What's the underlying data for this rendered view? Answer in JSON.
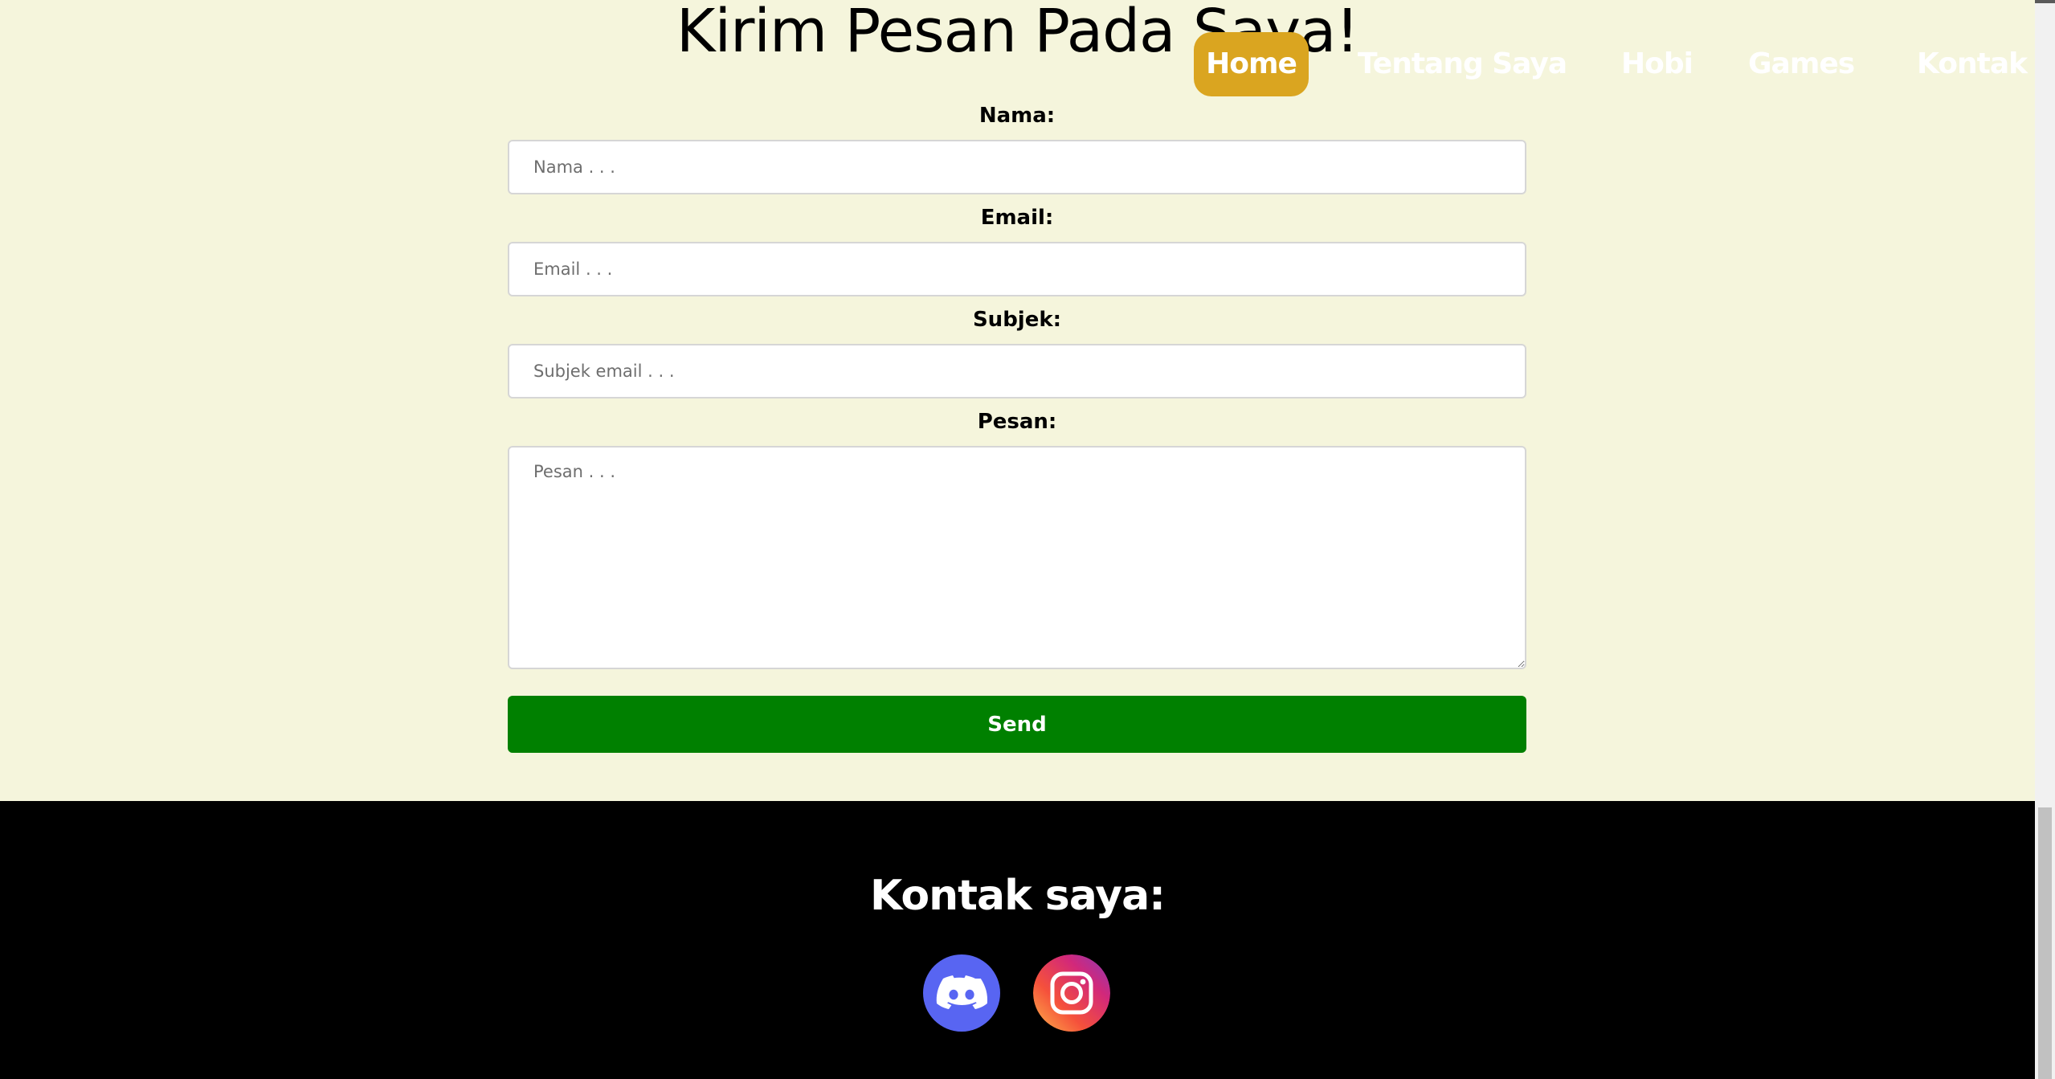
{
  "form": {
    "title": "Kirim Pesan Pada Saya!",
    "fields": [
      {
        "label": "Nama:",
        "placeholder": "Nama . . ."
      },
      {
        "label": "Email:",
        "placeholder": "Email . . ."
      },
      {
        "label": "Subjek:",
        "placeholder": "Subjek email . . ."
      },
      {
        "label": "Pesan:",
        "placeholder": "Pesan . . ."
      }
    ],
    "send_label": "Send"
  },
  "nav": {
    "items": [
      {
        "label": "Home",
        "active": true
      },
      {
        "label": "Tentang Saya",
        "active": false
      },
      {
        "label": "Hobi",
        "active": false
      },
      {
        "label": "Games",
        "active": false
      },
      {
        "label": "Kontak",
        "active": false
      }
    ]
  },
  "footer": {
    "title": "Kontak saya:",
    "social": [
      {
        "icon": "discord-icon"
      },
      {
        "icon": "instagram-icon"
      }
    ]
  },
  "colors": {
    "background": "#f5f5dc",
    "nav_active": "#daa520",
    "send_button": "#008000",
    "footer": "#000000",
    "discord": "#5865f2"
  }
}
